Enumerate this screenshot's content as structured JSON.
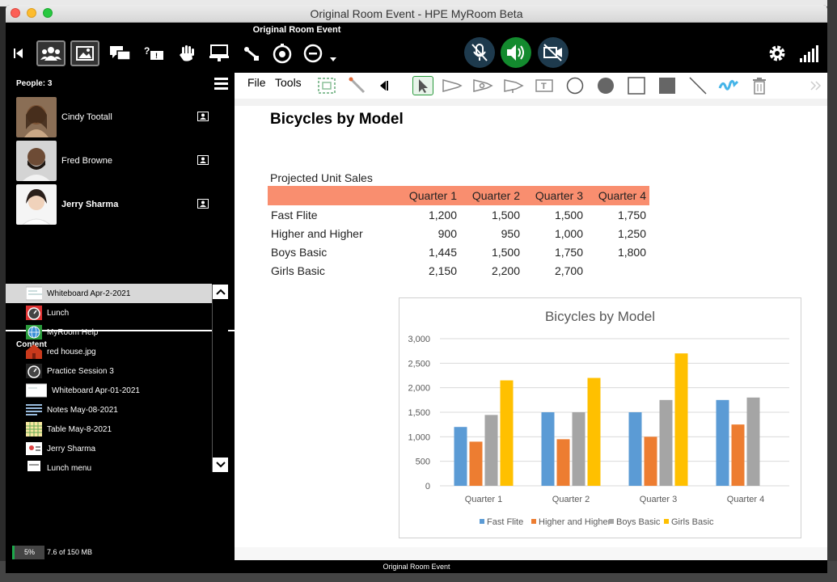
{
  "window": {
    "title": "Original Room Event - HPE MyRoom Beta"
  },
  "toolbar": {
    "room_title": "Original Room Event"
  },
  "people": {
    "header": "People: 3",
    "list": [
      {
        "name": "Cindy Tootall",
        "bold": false
      },
      {
        "name": "Fred Browne",
        "bold": false
      },
      {
        "name": "Jerry Sharma",
        "bold": true
      }
    ]
  },
  "content": {
    "header": "Content",
    "items": [
      {
        "label": "Whiteboard Apr-2-2021",
        "icon": "whiteboard-icon"
      },
      {
        "label": "Lunch",
        "icon": "session-icon"
      },
      {
        "label": "MyRoom Help",
        "icon": "web-icon"
      },
      {
        "label": "red house.jpg",
        "icon": "image-icon"
      },
      {
        "label": "Practice Session 3",
        "icon": "session-icon"
      },
      {
        "label": "Whiteboard Apr-01-2021",
        "icon": "whiteboard-icon"
      },
      {
        "label": "Notes May-08-2021",
        "icon": "notes-icon"
      },
      {
        "label": "Table May-8-2021",
        "icon": "table-icon"
      },
      {
        "label": "Jerry Sharma",
        "icon": "contact-icon"
      },
      {
        "label": "Lunch menu",
        "icon": "document-icon"
      }
    ],
    "storage_percent": "5%",
    "storage_text": "7.6 of 150 MB"
  },
  "whiteboard": {
    "menu_file": "File",
    "menu_tools": "Tools"
  },
  "document": {
    "title": "Bicycles by Model",
    "subtitle": "Projected Unit Sales",
    "table": {
      "headers": [
        "",
        "Quarter 1",
        "Quarter 2",
        "Quarter 3",
        "Quarter 4"
      ],
      "rows": [
        [
          "Fast Flite",
          "1,200",
          "1,500",
          "1,500",
          "1,750"
        ],
        [
          "Higher and Higher",
          "900",
          "950",
          "1,000",
          "1,250"
        ],
        [
          "Boys Basic",
          "1,445",
          "1,500",
          "1,750",
          "1,800"
        ],
        [
          "Girls Basic",
          "2,150",
          "2,200",
          "2,700",
          ""
        ]
      ]
    }
  },
  "chart_data": {
    "type": "bar",
    "title": "Bicycles by Model",
    "categories": [
      "Quarter 1",
      "Quarter 2",
      "Quarter 3",
      "Quarter 4"
    ],
    "series": [
      {
        "name": "Fast Flite",
        "values": [
          1200,
          1500,
          1500,
          1750
        ],
        "color": "#5b9bd5"
      },
      {
        "name": "Higher and Higher",
        "values": [
          900,
          950,
          1000,
          1250
        ],
        "color": "#ed7d31"
      },
      {
        "name": "Boys Basic",
        "values": [
          1445,
          1500,
          1750,
          1800
        ],
        "color": "#a5a5a5"
      },
      {
        "name": "Girls Basic",
        "values": [
          2150,
          2200,
          2700,
          null
        ],
        "color": "#ffc000"
      }
    ],
    "ylim": [
      0,
      3000
    ],
    "yticks": [
      "0",
      "500",
      "1,000",
      "1,500",
      "2,000",
      "2,500",
      "3,000"
    ],
    "grid": true,
    "legend": "bottom"
  },
  "status_bar": {
    "text": "Original Room Event"
  },
  "colors": {
    "mic_muted": "#1e3a4d",
    "speaker_on": "#138a2e",
    "video_off": "#1e3a4d",
    "highlight_header": "#f98e6f"
  }
}
